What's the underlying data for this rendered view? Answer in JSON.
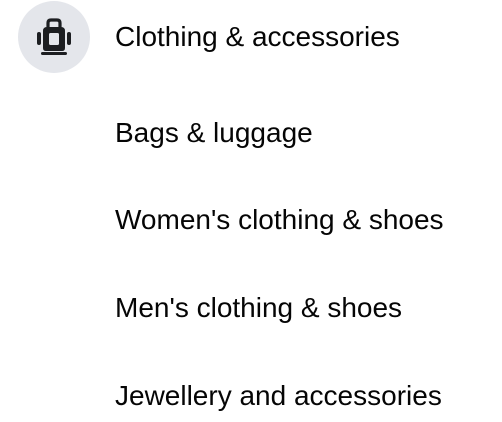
{
  "category": {
    "icon": "bag-icon",
    "title": "Clothing & accessories"
  },
  "subcategories": [
    {
      "label": "Bags & luggage"
    },
    {
      "label": "Women's clothing & shoes"
    },
    {
      "label": "Men's clothing & shoes"
    },
    {
      "label": "Jewellery and accessories"
    }
  ],
  "colors": {
    "icon_bg": "#e4e6eb",
    "text": "#050505",
    "icon": "#1c1e21"
  }
}
